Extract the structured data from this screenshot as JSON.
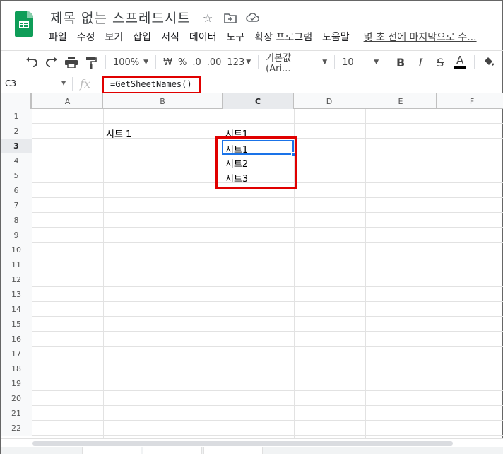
{
  "app": {
    "doc_title": "제목 없는 스프레드시트",
    "icons": [
      "star-icon",
      "move-to-folder-icon",
      "cloud-status-icon"
    ]
  },
  "menu": {
    "items": [
      "파일",
      "수정",
      "보기",
      "삽입",
      "서식",
      "데이터",
      "도구",
      "확장 프로그램",
      "도움말"
    ],
    "last_edit": "몇 초 전에 마지막으로 수..."
  },
  "toolbar": {
    "zoom": "100%",
    "currency": "₩",
    "percent": "%",
    "dec_decrease": ".0",
    "dec_increase": ".00",
    "more_formats": "123",
    "font": "기본값 (Ari...",
    "font_size": "10",
    "bold": "B",
    "italic": "I",
    "strike": "S",
    "text_color": "A"
  },
  "formula_bar": {
    "name_box": "C3",
    "fx": "fx",
    "formula": "=GetSheetNames()"
  },
  "grid": {
    "columns": [
      "A",
      "B",
      "C",
      "D",
      "E",
      "F"
    ],
    "rows": [
      "1",
      "2",
      "3",
      "4",
      "5",
      "6",
      "7",
      "8",
      "9",
      "10",
      "11",
      "12",
      "13",
      "14",
      "15",
      "16",
      "17",
      "18",
      "19",
      "20",
      "21",
      "22"
    ],
    "active_cell": "C3",
    "cells": {
      "B2": "시트 1",
      "C2": "시트1",
      "C3": "시트1",
      "C4": "시트2",
      "C5": "시트3"
    }
  },
  "colors": {
    "accent": "#1a73e8",
    "highlight_box": "#e00000",
    "brand": "#0f9d58"
  }
}
